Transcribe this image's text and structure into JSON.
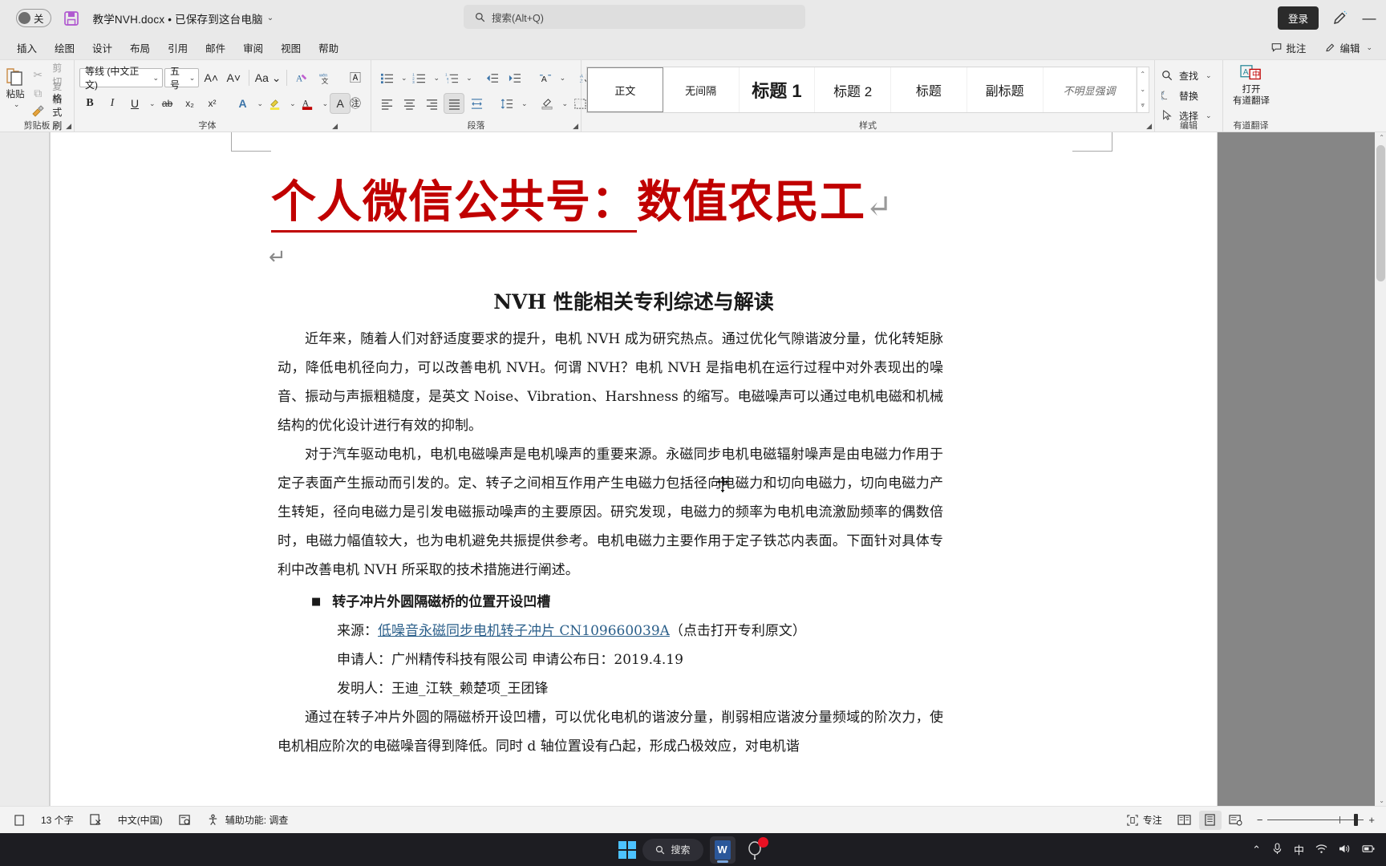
{
  "titlebar": {
    "autosave_label": "关",
    "save_icon": "save-icon",
    "doc_title": "教学NVH.docx • 已保存到这台电脑",
    "chevron": "⌄",
    "search_placeholder": "搜索(Alt+Q)",
    "search_icon": "search-icon",
    "login_label": "登录",
    "pen_icon": "pen-icon",
    "minimize_label": "—"
  },
  "menubar": {
    "items": [
      {
        "label": "插入"
      },
      {
        "label": "绘图"
      },
      {
        "label": "设计"
      },
      {
        "label": "布局"
      },
      {
        "label": "引用"
      },
      {
        "label": "邮件"
      },
      {
        "label": "审阅"
      },
      {
        "label": "视图"
      },
      {
        "label": "帮助"
      }
    ],
    "comment_label": "批注",
    "edit_label": "编辑",
    "edit_chevron": "⌄"
  },
  "ribbon": {
    "clipboard": {
      "group_label": "剪贴板",
      "paste_label": "粘贴",
      "cut_label": "剪切",
      "copy_label": "复制",
      "format_painter_label": "格式刷"
    },
    "font": {
      "group_label": "字体",
      "font_name": "等线 (中文正文)",
      "font_size": "五号",
      "grow_icon": "grow-font-icon",
      "shrink_icon": "shrink-font-icon",
      "case_icon": "change-case-icon",
      "clear_format_icon": "clear-formatting-icon",
      "phonetic_icon": "phonetic-guide-icon",
      "bold": "B",
      "italic": "I",
      "underline": "U",
      "strike": "ab",
      "subscript": "x₂",
      "superscript": "x²",
      "text_effects_icon": "text-effects-icon",
      "highlight_icon": "text-highlight-icon",
      "font_color_icon": "font-color-icon",
      "char_shading_icon": "character-shading-icon",
      "char_border_icon": "character-border-icon",
      "enclose_char_icon": "enclose-character-icon"
    },
    "paragraph": {
      "group_label": "段落",
      "bullets_icon": "bullet-list-icon",
      "numbering_icon": "numbered-list-icon",
      "multilevel_icon": "multilevel-list-icon",
      "decrease_indent_icon": "decrease-indent-icon",
      "increase_indent_icon": "increase-indent-icon",
      "cjk_align_icon": "cjk-text-align-icon",
      "sort_icon": "sort-icon",
      "show_marks_icon": "show-paragraph-marks-icon",
      "align_left_icon": "align-left-icon",
      "align_center_icon": "align-center-icon",
      "align_right_icon": "align-right-icon",
      "justify_icon": "justify-icon",
      "distribute_icon": "distribute-icon",
      "line_spacing_icon": "line-spacing-icon",
      "shading_icon": "shading-icon",
      "borders_icon": "borders-icon"
    },
    "styles": {
      "group_label": "样式",
      "items": [
        {
          "label": "正文",
          "active": true
        },
        {
          "label": "无间隔",
          "active": false
        },
        {
          "label": "标题 1",
          "active": false
        },
        {
          "label": "标题 2",
          "active": false
        },
        {
          "label": "标题",
          "active": false
        },
        {
          "label": "副标题",
          "active": false
        },
        {
          "label": "不明显强调",
          "active": false
        }
      ]
    },
    "editing": {
      "group_label": "编辑",
      "find_label": "查找",
      "replace_label": "替换",
      "select_label": "选择",
      "find_icon": "search-icon",
      "replace_icon": "replace-icon",
      "select_icon": "cursor-arrow-icon"
    },
    "yodao": {
      "group_label": "有道翻译",
      "open_label": "打开",
      "app_label": "有道翻译",
      "icon": "translate-icon"
    }
  },
  "document": {
    "red_heading_underlined": "个人微信公共号：",
    "red_heading_rest": "数值农民工",
    "paragraph_mark": "↵",
    "title": "NVH 性能相关专利综述与解读",
    "paragraphs": [
      "近年来，随着人们对舒适度要求的提升，电机 NVH 成为研究热点。通过优化气隙谐波分量，优化转矩脉动，降低电机径向力，可以改善电机 NVH。何谓 NVH？电机 NVH 是指电机在运行过程中对外表现出的噪音、振动与声振粗糙度，是英文 Noise、Vibration、Harshness 的缩写。电磁噪声可以通过电机电磁和机械结构的优化设计进行有效的抑制。",
      "对于汽车驱动电机，电机电磁噪声是电机噪声的重要来源。永磁同步电机电磁辐射噪声是由电磁力作用于定子表面产生振动而引发的。定、转子之间相互作用产生电磁力包括径向电磁力和切向电磁力，切向电磁力产生转矩，径向电磁力是引发电磁振动噪声的主要原因。研究发现，电磁力的频率为电机电流激励频率的偶数倍时，电磁力幅值较大，也为电机避免共振提供参考。电机电磁力主要作用于定子铁芯内表面。下面针对具体专利中改善电机 NVH 所采取的技术措施进行阐述。"
    ],
    "bullet_symbol": "■",
    "bullet_title": "转子冲片外圆隔磁桥的位置开设凹槽",
    "source_label": "来源：",
    "source_link": "低噪音永磁同步电机转子冲片 CN109660039A",
    "source_note": "（点击打开专利原文）",
    "applicant_line": "申请人：广州精传科技有限公司  申请公布日：2019.4.19",
    "inventor_line": "发明人：王迪_江轶_赖楚项_王团锋",
    "last_paragraph": "通过在转子冲片外圆的隔磁桥开设凹槽，可以优化电机的谐波分量，削弱相应谐波分量频域的阶次力，使电机相应阶次的电磁噪音得到降低。同时 d 轴位置设有凸起，形成凸极效应，对电机谐"
  },
  "statusbar": {
    "page_icon": "page-count-icon",
    "word_count": "13 个字",
    "proof_icon": "proofing-icon",
    "language": "中文(中国)",
    "track_icon": "track-changes-icon",
    "accessibility_icon": "accessibility-icon",
    "accessibility_label": "辅助功能: 调查",
    "focus_icon": "focus-mode-icon",
    "focus_label": "专注",
    "view_read_icon": "read-mode-icon",
    "view_print_icon": "print-layout-icon",
    "view_web_icon": "web-layout-icon",
    "zoom_minus": "−",
    "zoom_plus": "+"
  },
  "taskbar": {
    "start_icon": "windows-start-icon",
    "search_label": "搜索",
    "search_icon": "search-icon",
    "word_app": "W",
    "second_app_icon": "app-icon",
    "tray": {
      "chevron_up": "⌃",
      "mic_icon": "microphone-icon",
      "ime_label": "中",
      "wifi_icon": "wifi-icon",
      "volume_icon": "volume-icon",
      "battery_icon": "battery-icon"
    }
  },
  "colors": {
    "accent_red": "#c00000",
    "link_blue": "#2b5f8a",
    "taskbar_bg": "#1d1d22",
    "ribbon_bg": "#f3f3f3"
  }
}
